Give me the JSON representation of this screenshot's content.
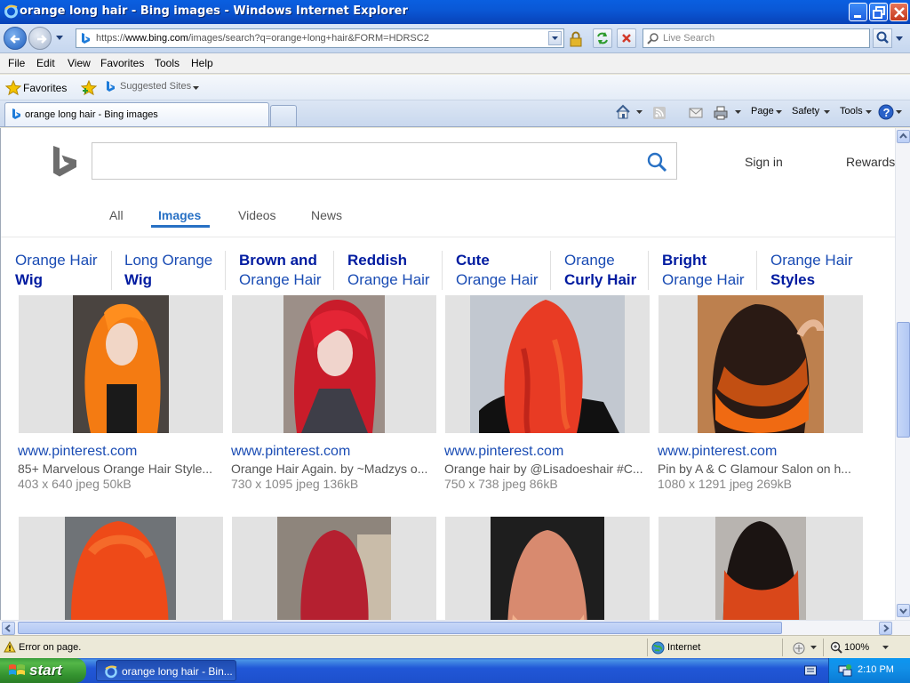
{
  "window": {
    "title": "orange long hair - Bing images - Windows Internet Explorer"
  },
  "address_bar": {
    "url_prefix": "https://",
    "url_host": "www.bing.com",
    "url_path": "/images/search?q=orange+long+hair&FORM=HDRSC2"
  },
  "search_box": {
    "placeholder": "Live Search"
  },
  "menu": [
    "File",
    "Edit",
    "View",
    "Favorites",
    "Tools",
    "Help"
  ],
  "favorites_bar": {
    "favorites_label": "Favorites",
    "suggested_label": "Suggested Sites"
  },
  "tabs": {
    "active_label": "orange long hair - Bing images"
  },
  "command_bar": {
    "page": "Page",
    "safety": "Safety",
    "tools": "Tools"
  },
  "bing": {
    "search_value": "",
    "sign_in": "Sign in",
    "rewards": "Rewards",
    "nav": [
      {
        "label": "All",
        "active": false
      },
      {
        "label": "Images",
        "active": true
      },
      {
        "label": "Videos",
        "active": false
      },
      {
        "label": "News",
        "active": false
      }
    ],
    "related": [
      {
        "line1": "Orange Hair",
        "line2": "Wig"
      },
      {
        "line1": "Long Orange",
        "line2": "Wig"
      },
      {
        "line1": "Brown and",
        "line2": "Orange Hair"
      },
      {
        "line1": "Reddish",
        "line2": "Orange Hair"
      },
      {
        "line1": "Cute",
        "line2": "Orange Hair"
      },
      {
        "line1": "Orange",
        "line2": "Curly Hair"
      },
      {
        "line1": "Bright",
        "line2": "Orange Hair"
      },
      {
        "line1": "Orange Hair",
        "line2": "Styles"
      }
    ],
    "results": [
      {
        "site": "www.pinterest.com",
        "desc": "85+ Marvelous Orange Hair Style...",
        "info": "403 x 640 jpeg 50kB"
      },
      {
        "site": "www.pinterest.com",
        "desc": "Orange Hair Again. by ~Madzys o...",
        "info": "730 x 1095 jpeg 136kB"
      },
      {
        "site": "www.pinterest.com",
        "desc": "Orange hair by @Lisadoeshair #C...",
        "info": "750 x 738 jpeg 86kB"
      },
      {
        "site": "www.pinterest.com",
        "desc": "Pin by A & C Glamour Salon on h...",
        "info": "1080 x 1291 jpeg 269kB"
      }
    ]
  },
  "status_bar": {
    "message": "Error on page.",
    "zone": "Internet",
    "zoom": "100%"
  },
  "taskbar": {
    "start": "start",
    "item": "orange long hair - Bin...",
    "clock": "2:10 PM"
  },
  "colors": {
    "bing_link": "#1A4CB4",
    "bing_bold_link": "#001BA0",
    "bing_active_tab": "#2770C4",
    "hair_orange": "#F26A1B"
  }
}
